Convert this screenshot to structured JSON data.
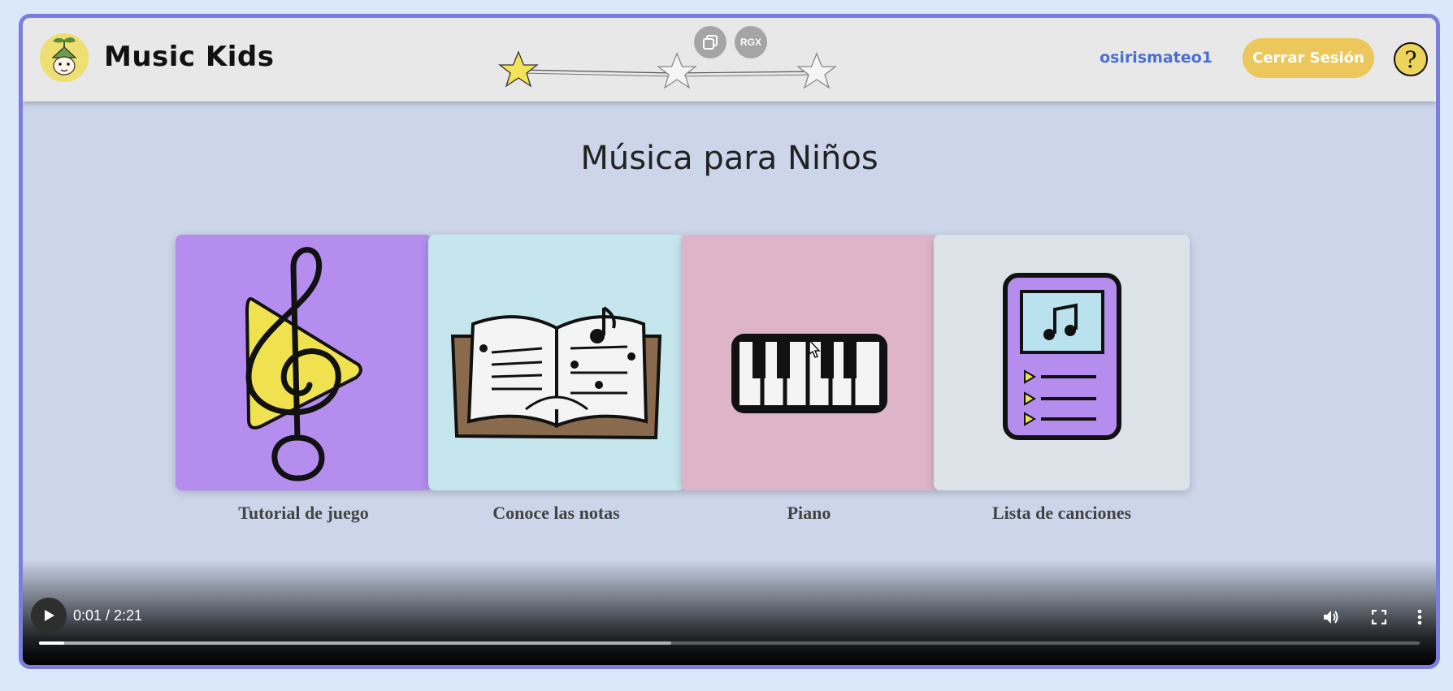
{
  "header": {
    "app_title": "Music Kids",
    "username": "osirismateo1",
    "logout_label": "Cerrar Sesión",
    "help_label": "?",
    "overlay_buttons": {
      "copy_icon": "copy-icon",
      "rgx_label": "RGX"
    },
    "stars": {
      "filled": 1,
      "total": 3
    }
  },
  "main": {
    "title": "Música para Niños",
    "cards": [
      {
        "label": "Tutorial de juego",
        "icon": "treble-clef-play-icon",
        "bg": "#b48dee"
      },
      {
        "label": "Conoce las notas",
        "icon": "music-book-icon",
        "bg": "#c6e6ee"
      },
      {
        "label": "Piano",
        "icon": "piano-keys-icon",
        "bg": "#ddb4c8"
      },
      {
        "label": "Lista de canciones",
        "icon": "playlist-device-icon",
        "bg": "#dde2e8"
      }
    ]
  },
  "video": {
    "time_display": "0:01 / 2:21",
    "played_fraction": 0.018,
    "buffered_fraction": 0.458
  },
  "colors": {
    "accent_star": "#f2e35a",
    "logout_bg": "#ecc75b",
    "username": "#4a6fd0",
    "frame_border": "#7a7fdc"
  }
}
